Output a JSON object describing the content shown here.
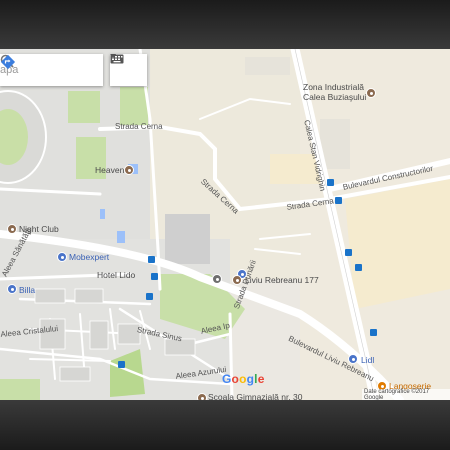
{
  "search": {
    "placeholder": "apa",
    "search_icon": "search-icon",
    "directions_icon": "directions-icon",
    "keyboard_icon": "keyboard-icon"
  },
  "map": {
    "streets": {
      "strada_cerna_top": "Strada Cerna",
      "strada_cerna_diag": "Strada Cerna",
      "strada_cerna_mid": "Strada Cerna",
      "calea_stan_vidrighin": "Calea Stan Vidrighin",
      "bulevardul_constructorilor": "Bulevardul Constructorilor",
      "aleea_sanatatii": "Aleea Sănătăţii",
      "strada_sinus": "Strada Sinus",
      "aleea_ip": "Aleea Ip",
      "strada_dunarii": "Strada Dunării",
      "aleea_cristalului": "Aleea Cristalului",
      "aleea_azurului": "Aleea Azurului",
      "bulevardul_liviu_rebreanu": "Bulevardul Liviu Rebreanu"
    },
    "places": {
      "zona_industriala": "Zona Industrială Calea Buziaşului",
      "heaven": "Heaven",
      "night_club": "Night Club",
      "mobexpert": "Mobexpert",
      "hotel_lido": "Hotel Lido",
      "liviu_rebreanu_177": "Liviu Rebreanu 177",
      "billa": "Billa",
      "lidl": "Lidl",
      "langoserie": "Langoserie",
      "scoala": "Şcoala Gimnazială nr. 30"
    },
    "logo": {
      "g1": "G",
      "o1": "o",
      "o2": "o",
      "g2": "g",
      "l": "l",
      "e": "e"
    },
    "attribution": "Date cartografice ©2017 Google",
    "colors": {
      "background": "#ebe8e2",
      "road": "#ffffff",
      "park": "#c8dfa8",
      "industrial": "#f5ebcf",
      "transit_blue": "#1a73c9"
    }
  }
}
